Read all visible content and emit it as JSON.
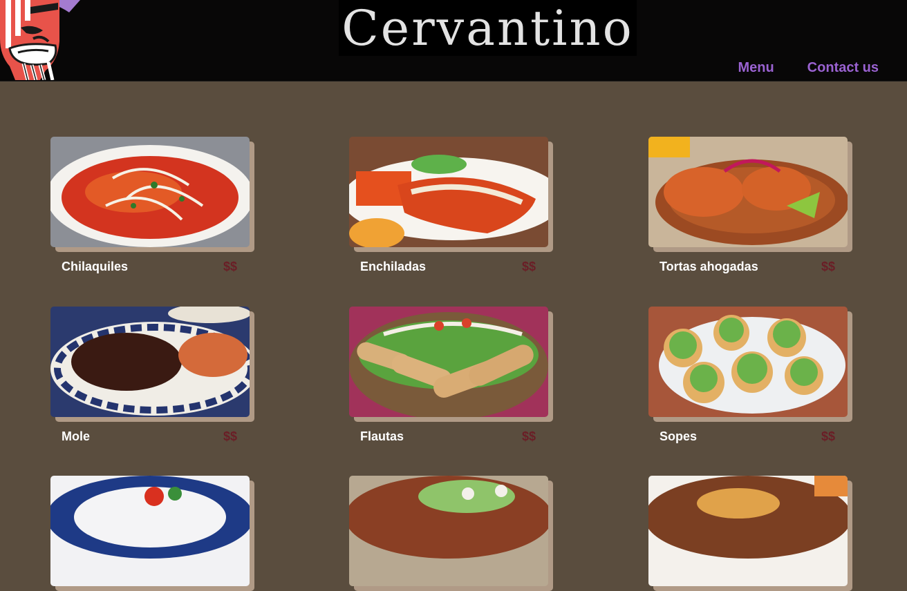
{
  "header": {
    "brand": "Cervantino",
    "nav": [
      {
        "label": "Menu"
      },
      {
        "label": "Contact us"
      }
    ]
  },
  "menu": {
    "items": [
      {
        "name": "Chilaquiles",
        "price": "$$"
      },
      {
        "name": "Enchiladas",
        "price": "$$"
      },
      {
        "name": "Tortas ahogadas",
        "price": "$$"
      },
      {
        "name": "Mole",
        "price": "$$"
      },
      {
        "name": "Flautas",
        "price": "$$"
      },
      {
        "name": "Sopes",
        "price": "$$"
      },
      {
        "name": "",
        "price": ""
      },
      {
        "name": "",
        "price": ""
      },
      {
        "name": "",
        "price": ""
      }
    ]
  },
  "colors": {
    "page_bg": "#5a4d3e",
    "header_bg": "#080707",
    "nav_link": "#9a62d1",
    "price": "#6a1e26",
    "card_shadow": "#b09a86"
  }
}
